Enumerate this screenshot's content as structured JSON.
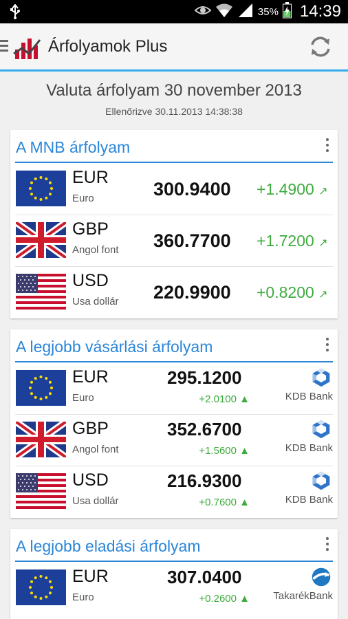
{
  "status_bar": {
    "battery_percent": "35%",
    "time": "14:39",
    "icons": [
      "usb-icon",
      "eye-icon",
      "wifi-icon",
      "signal-icon",
      "battery-icon"
    ]
  },
  "app_bar": {
    "title": "Árfolyamok Plus",
    "icons": [
      "menu-icon",
      "app-logo-icon",
      "refresh-icon"
    ]
  },
  "header": {
    "title": "Valuta árfolyam 30 november 2013",
    "checked": "Ellenőrizve 30.11.2013 14:38:38"
  },
  "colors": {
    "accent": "#2a86d8",
    "positive": "#3dab3d"
  },
  "mnb": {
    "title": "A MNB árfolyam",
    "rows": [
      {
        "code": "EUR",
        "name": "Euro",
        "rate": "300.9400",
        "change": "+1.4900",
        "flag": "eu-flag-icon"
      },
      {
        "code": "GBP",
        "name": "Angol font",
        "rate": "360.7700",
        "change": "+1.7200",
        "flag": "uk-flag-icon"
      },
      {
        "code": "USD",
        "name": "Usa dollár",
        "rate": "220.9900",
        "change": "+0.8200",
        "flag": "us-flag-icon"
      }
    ]
  },
  "buy": {
    "title": "A legjobb vásárlási árfolyam",
    "rows": [
      {
        "code": "EUR",
        "name": "Euro",
        "rate": "295.1200",
        "change": "+2.0100",
        "bank": "KDB Bank"
      },
      {
        "code": "GBP",
        "name": "Angol font",
        "rate": "352.6700",
        "change": "+1.5600",
        "bank": "KDB Bank"
      },
      {
        "code": "USD",
        "name": "Usa dollár",
        "rate": "216.9300",
        "change": "+0.7600",
        "bank": "KDB Bank"
      }
    ]
  },
  "sell": {
    "title": "A legjobb eladási árfolyam",
    "rows": [
      {
        "code": "EUR",
        "name": "Euro",
        "rate": "307.0400",
        "change": "+0.2600",
        "bank": "TakarékBank"
      }
    ]
  }
}
